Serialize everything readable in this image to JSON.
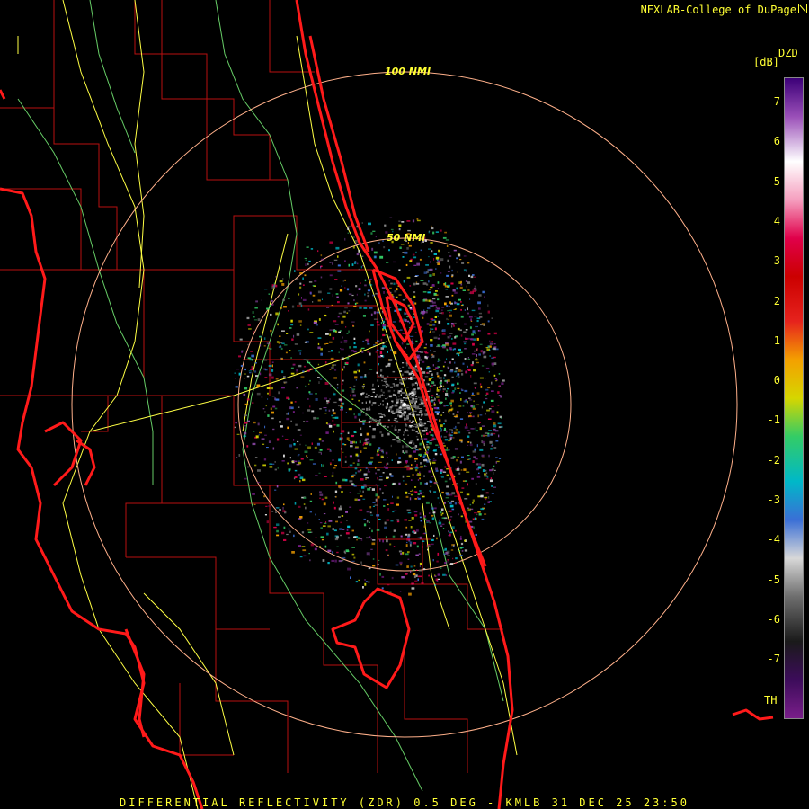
{
  "credit": "NEXLAB-College of DuPage",
  "colorbar": {
    "product_code": "DZD",
    "unit": "[dB]",
    "ticks": [
      "7",
      "6",
      "5",
      "4",
      "3",
      "2",
      "1",
      "0",
      "-1",
      "-2",
      "-3",
      "-4",
      "-5",
      "-6",
      "-7"
    ],
    "threshold_label": "TH",
    "colors": [
      "#3c0078",
      "#9a4fb8",
      "#ffffff",
      "#f59fbf",
      "#e0004a",
      "#cc0000",
      "#e6231d",
      "#f4a000",
      "#d6d600",
      "#33cc66",
      "#00b8c8",
      "#3a6fd6",
      "#d8d8d8",
      "#6e6e6e",
      "#1a1a1a",
      "#3c0c5a",
      "#7a1e8a"
    ]
  },
  "range_rings": [
    "100 NMI",
    "50 NMI"
  ],
  "footer": "DIFFERENTIAL REFLECTIVITY (ZDR) 0.5 DEG - KMLB 31 DEC 25 23:50",
  "colors": {
    "coast": "#ff1a1a",
    "county": "#b81010",
    "road": "#ffff44",
    "river": "#66cc66",
    "ring": "#ffb08a",
    "text": "#ffff33"
  }
}
